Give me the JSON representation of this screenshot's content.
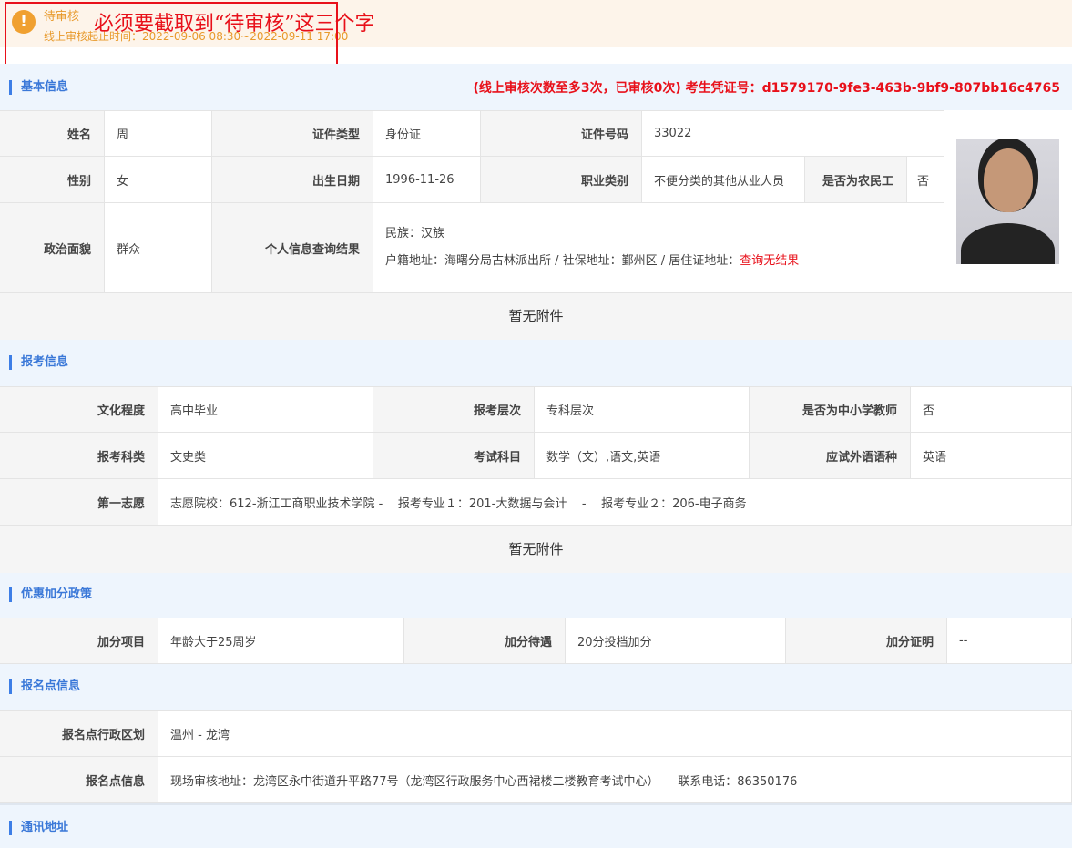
{
  "status": {
    "icon": "!",
    "title": "待审核",
    "time_range": "线上审核起止时间：2022-09-06 08:30~2022-09-11 17:00"
  },
  "annotation": "必须要截取到“待审核”这三个字",
  "basic": {
    "title": "基本信息",
    "note": "(线上审核次数至多3次，已审核0次) 考生凭证号：d1579170-9fe3-463b-9bf9-807bb16c4765",
    "name_label": "姓名",
    "name": "周",
    "id_type_label": "证件类型",
    "id_type": "身份证",
    "id_no_label": "证件号码",
    "id_no": "33022",
    "gender_label": "性别",
    "gender": "女",
    "birth_label": "出生日期",
    "birth": "1996-11-26",
    "job_label": "职业类别",
    "job": "不便分类的其他从业人员",
    "farmer_label": "是否为农民工",
    "farmer": "否",
    "political_label": "政治面貌",
    "political": "群众",
    "query_label": "个人信息查询结果",
    "ethnic": "民族：汉族",
    "address_prefix": "户籍地址：海曙分局古林派出所 / 社保地址：鄞州区 / 居住证地址：",
    "address_result": "查询无结果"
  },
  "no_attachment": "暂无附件",
  "exam": {
    "title": "报考信息",
    "edu_label": "文化程度",
    "edu": "高中毕业",
    "level_label": "报考层次",
    "level": "专科层次",
    "teacher_label": "是否为中小学教师",
    "teacher": "否",
    "category_label": "报考科类",
    "category": "文史类",
    "subjects_label": "考试科目",
    "subjects": "数学（文）,语文,英语",
    "lang_label": "应试外语语种",
    "lang": "英语",
    "choice_label": "第一志愿",
    "choice": "志愿院校：612-浙江工商职业技术学院 -    报考专业１：201-大数据与会计    -    报考专业２：206-电子商务"
  },
  "bonus": {
    "title": "优惠加分政策",
    "item_label": "加分项目",
    "item": "年龄大于25周岁",
    "treat_label": "加分待遇",
    "treat": "20分投档加分",
    "proof_label": "加分证明",
    "proof": "--"
  },
  "site": {
    "title": "报名点信息",
    "region_label": "报名点行政区划",
    "region": "温州 - 龙湾",
    "info_label": "报名点信息",
    "info": "现场审核地址：龙湾区永中街道升平路77号（龙湾区行政服务中心西裙楼二楼教育考试中心）     联系电话：86350176"
  },
  "contact": {
    "title": "通讯地址"
  },
  "colors": {
    "accent": "#3a78d8",
    "warning": "#f0a030",
    "alert_red": "#e8101a"
  }
}
